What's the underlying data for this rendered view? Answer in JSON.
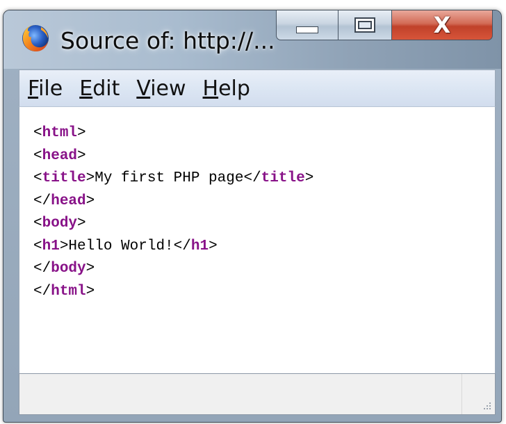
{
  "window": {
    "title": "Source of: http://...",
    "icon": "firefox-icon",
    "controls": {
      "minimize_icon": "minimize-icon",
      "maximize_icon": "maximize-icon",
      "close_icon": "close-icon",
      "close_glyph": "X"
    }
  },
  "menubar": {
    "items": [
      {
        "first": "F",
        "rest": "ile"
      },
      {
        "first": "E",
        "rest": "dit"
      },
      {
        "first": "V",
        "rest": "iew"
      },
      {
        "first": "H",
        "rest": "elp"
      }
    ]
  },
  "source": {
    "lines": [
      [
        {
          "t": "<"
        },
        {
          "t": "html",
          "tag": true
        },
        {
          "t": ">"
        }
      ],
      [
        {
          "t": "<"
        },
        {
          "t": "head",
          "tag": true
        },
        {
          "t": ">"
        }
      ],
      [
        {
          "t": "<"
        },
        {
          "t": "title",
          "tag": true
        },
        {
          "t": ">My first PHP page</"
        },
        {
          "t": "title",
          "tag": true
        },
        {
          "t": ">"
        }
      ],
      [
        {
          "t": "</"
        },
        {
          "t": "head",
          "tag": true
        },
        {
          "t": ">"
        }
      ],
      [
        {
          "t": "<"
        },
        {
          "t": "body",
          "tag": true
        },
        {
          "t": ">"
        }
      ],
      [
        {
          "t": "<"
        },
        {
          "t": "h1",
          "tag": true
        },
        {
          "t": ">Hello World!</"
        },
        {
          "t": "h1",
          "tag": true
        },
        {
          "t": ">"
        }
      ],
      [
        {
          "t": "</"
        },
        {
          "t": "body",
          "tag": true
        },
        {
          "t": ">"
        }
      ],
      [
        {
          "t": "</"
        },
        {
          "t": "html",
          "tag": true
        },
        {
          "t": ">"
        }
      ]
    ]
  },
  "statusbar": {
    "text": "",
    "grip_icon": "resize-grip-icon"
  },
  "colors": {
    "tag_name": "#881288",
    "close_button": "#c0412a",
    "menubar": "#dce6f3"
  }
}
